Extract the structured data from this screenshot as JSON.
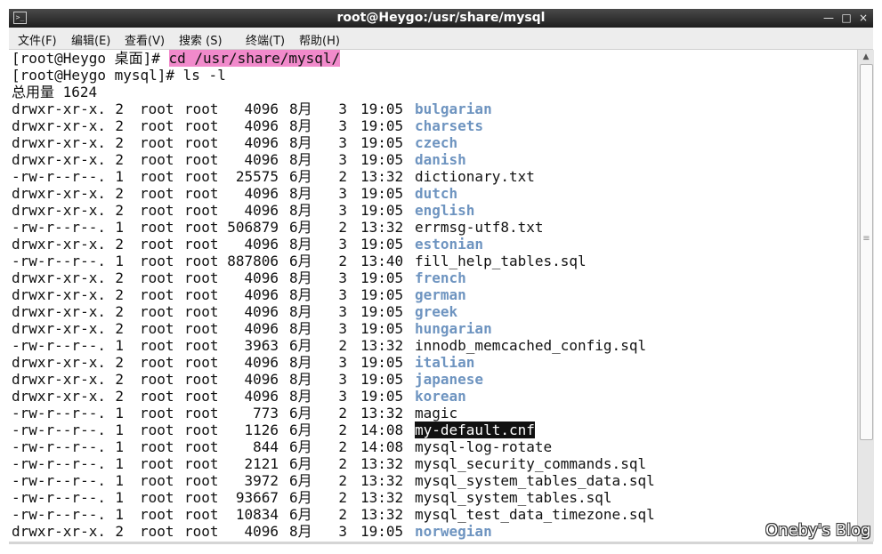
{
  "window": {
    "title": "root@Heygo:/usr/share/mysql",
    "app_icon": "terminal-icon",
    "buttons": {
      "minimize": "—",
      "maximize": "□",
      "close": "×"
    }
  },
  "menu": [
    "文件(F)",
    "编辑(E)",
    "查看(V)",
    "搜索 (S)",
    "终端(T)",
    "帮助(H)"
  ],
  "terminal": {
    "prompt1": "[root@Heygo 桌面]# ",
    "cmd1": "cd /usr/share/mysql/",
    "prompt2": "[root@Heygo mysql]# ",
    "cmd2": "ls -l",
    "total": "总用量 1624",
    "entries": [
      {
        "perm": "drwxr-xr-x.",
        "links": "2",
        "user": "root",
        "group": "root",
        "size": "4096",
        "month": "8月",
        "day": "3",
        "time": "19:05",
        "name": "bulgarian",
        "dir": true
      },
      {
        "perm": "drwxr-xr-x.",
        "links": "2",
        "user": "root",
        "group": "root",
        "size": "4096",
        "month": "8月",
        "day": "3",
        "time": "19:05",
        "name": "charsets",
        "dir": true
      },
      {
        "perm": "drwxr-xr-x.",
        "links": "2",
        "user": "root",
        "group": "root",
        "size": "4096",
        "month": "8月",
        "day": "3",
        "time": "19:05",
        "name": "czech",
        "dir": true
      },
      {
        "perm": "drwxr-xr-x.",
        "links": "2",
        "user": "root",
        "group": "root",
        "size": "4096",
        "month": "8月",
        "day": "3",
        "time": "19:05",
        "name": "danish",
        "dir": true
      },
      {
        "perm": "-rw-r--r--.",
        "links": "1",
        "user": "root",
        "group": "root",
        "size": "25575",
        "month": "6月",
        "day": "2",
        "time": "13:32",
        "name": "dictionary.txt",
        "dir": false
      },
      {
        "perm": "drwxr-xr-x.",
        "links": "2",
        "user": "root",
        "group": "root",
        "size": "4096",
        "month": "8月",
        "day": "3",
        "time": "19:05",
        "name": "dutch",
        "dir": true
      },
      {
        "perm": "drwxr-xr-x.",
        "links": "2",
        "user": "root",
        "group": "root",
        "size": "4096",
        "month": "8月",
        "day": "3",
        "time": "19:05",
        "name": "english",
        "dir": true
      },
      {
        "perm": "-rw-r--r--.",
        "links": "1",
        "user": "root",
        "group": "root",
        "size": "506879",
        "month": "6月",
        "day": "2",
        "time": "13:32",
        "name": "errmsg-utf8.txt",
        "dir": false
      },
      {
        "perm": "drwxr-xr-x.",
        "links": "2",
        "user": "root",
        "group": "root",
        "size": "4096",
        "month": "8月",
        "day": "3",
        "time": "19:05",
        "name": "estonian",
        "dir": true
      },
      {
        "perm": "-rw-r--r--.",
        "links": "1",
        "user": "root",
        "group": "root",
        "size": "887806",
        "month": "6月",
        "day": "2",
        "time": "13:40",
        "name": "fill_help_tables.sql",
        "dir": false
      },
      {
        "perm": "drwxr-xr-x.",
        "links": "2",
        "user": "root",
        "group": "root",
        "size": "4096",
        "month": "8月",
        "day": "3",
        "time": "19:05",
        "name": "french",
        "dir": true
      },
      {
        "perm": "drwxr-xr-x.",
        "links": "2",
        "user": "root",
        "group": "root",
        "size": "4096",
        "month": "8月",
        "day": "3",
        "time": "19:05",
        "name": "german",
        "dir": true
      },
      {
        "perm": "drwxr-xr-x.",
        "links": "2",
        "user": "root",
        "group": "root",
        "size": "4096",
        "month": "8月",
        "day": "3",
        "time": "19:05",
        "name": "greek",
        "dir": true
      },
      {
        "perm": "drwxr-xr-x.",
        "links": "2",
        "user": "root",
        "group": "root",
        "size": "4096",
        "month": "8月",
        "day": "3",
        "time": "19:05",
        "name": "hungarian",
        "dir": true
      },
      {
        "perm": "-rw-r--r--.",
        "links": "1",
        "user": "root",
        "group": "root",
        "size": "3963",
        "month": "6月",
        "day": "2",
        "time": "13:32",
        "name": "innodb_memcached_config.sql",
        "dir": false
      },
      {
        "perm": "drwxr-xr-x.",
        "links": "2",
        "user": "root",
        "group": "root",
        "size": "4096",
        "month": "8月",
        "day": "3",
        "time": "19:05",
        "name": "italian",
        "dir": true
      },
      {
        "perm": "drwxr-xr-x.",
        "links": "2",
        "user": "root",
        "group": "root",
        "size": "4096",
        "month": "8月",
        "day": "3",
        "time": "19:05",
        "name": "japanese",
        "dir": true
      },
      {
        "perm": "drwxr-xr-x.",
        "links": "2",
        "user": "root",
        "group": "root",
        "size": "4096",
        "month": "8月",
        "day": "3",
        "time": "19:05",
        "name": "korean",
        "dir": true
      },
      {
        "perm": "-rw-r--r--.",
        "links": "1",
        "user": "root",
        "group": "root",
        "size": "773",
        "month": "6月",
        "day": "2",
        "time": "13:32",
        "name": "magic",
        "dir": false
      },
      {
        "perm": "-rw-r--r--.",
        "links": "1",
        "user": "root",
        "group": "root",
        "size": "1126",
        "month": "6月",
        "day": "2",
        "time": "14:08",
        "name": "my-default.cnf",
        "dir": false,
        "highlight": true
      },
      {
        "perm": "-rw-r--r--.",
        "links": "1",
        "user": "root",
        "group": "root",
        "size": "844",
        "month": "6月",
        "day": "2",
        "time": "14:08",
        "name": "mysql-log-rotate",
        "dir": false
      },
      {
        "perm": "-rw-r--r--.",
        "links": "1",
        "user": "root",
        "group": "root",
        "size": "2121",
        "month": "6月",
        "day": "2",
        "time": "13:32",
        "name": "mysql_security_commands.sql",
        "dir": false
      },
      {
        "perm": "-rw-r--r--.",
        "links": "1",
        "user": "root",
        "group": "root",
        "size": "3972",
        "month": "6月",
        "day": "2",
        "time": "13:32",
        "name": "mysql_system_tables_data.sql",
        "dir": false
      },
      {
        "perm": "-rw-r--r--.",
        "links": "1",
        "user": "root",
        "group": "root",
        "size": "93667",
        "month": "6月",
        "day": "2",
        "time": "13:32",
        "name": "mysql_system_tables.sql",
        "dir": false
      },
      {
        "perm": "-rw-r--r--.",
        "links": "1",
        "user": "root",
        "group": "root",
        "size": "10834",
        "month": "6月",
        "day": "2",
        "time": "13:32",
        "name": "mysql_test_data_timezone.sql",
        "dir": false
      },
      {
        "perm": "drwxr-xr-x.",
        "links": "2",
        "user": "root",
        "group": "root",
        "size": "4096",
        "month": "8月",
        "day": "3",
        "time": "19:05",
        "name": "norwegian",
        "dir": true
      }
    ]
  },
  "colors": {
    "directory": "#6e94c0",
    "command_highlight": "#f18acb",
    "selection": "#111111"
  },
  "watermark": "Oneby's Blog"
}
